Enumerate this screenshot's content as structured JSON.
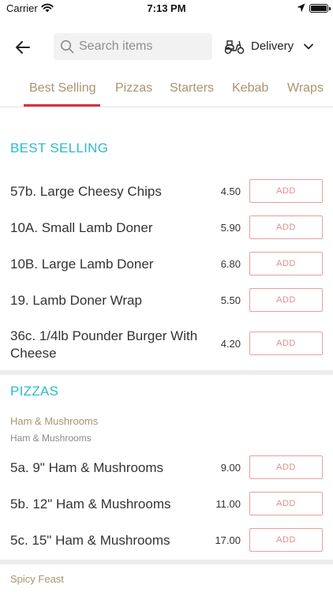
{
  "status_bar": {
    "carrier": "Carrier",
    "time": "7:13 PM",
    "icons": [
      "wifi-icon",
      "location-icon",
      "battery-icon"
    ]
  },
  "header": {
    "back_icon": "arrow-left-icon",
    "search": {
      "placeholder": "Search items",
      "value": ""
    },
    "delivery": {
      "label": "Delivery",
      "icon": "scooter-icon"
    }
  },
  "tabs": [
    {
      "label": "Best Selling",
      "active": true
    },
    {
      "label": "Pizzas",
      "active": false
    },
    {
      "label": "Starters",
      "active": false
    },
    {
      "label": "Kebab",
      "active": false
    },
    {
      "label": "Wraps",
      "active": false
    }
  ],
  "colors": {
    "accent_teal": "#2bbcc9",
    "tab_text": "#a8946f",
    "active_indicator": "#d8313c",
    "add_button_border": "#e4a0a3"
  },
  "sections": {
    "best_selling": {
      "title": "BEST SELLING",
      "items": [
        {
          "name": "57b. Large Cheesy Chips",
          "price": "4.50",
          "button": "ADD"
        },
        {
          "name": "10A. Small Lamb Doner",
          "price": "5.90",
          "button": "ADD"
        },
        {
          "name": "10B. Large Lamb Doner",
          "price": "6.80",
          "button": "ADD"
        },
        {
          "name": "19. Lamb Doner Wrap",
          "price": "5.50",
          "button": "ADD"
        },
        {
          "name": "36c. 1/4lb Pounder Burger With Cheese",
          "price": "4.20",
          "button": "ADD"
        }
      ]
    },
    "pizzas": {
      "title": "PIZZAS",
      "group": {
        "title": "Ham & Mushrooms",
        "subtitle": "Ham & Mushrooms",
        "items": [
          {
            "name": "5a. 9\" Ham & Mushrooms",
            "price": "9.00",
            "button": "ADD"
          },
          {
            "name": "5b. 12\" Ham & Mushrooms",
            "price": "11.00",
            "button": "ADD"
          },
          {
            "name": "5c. 15\" Ham & Mushrooms",
            "price": "17.00",
            "button": "ADD"
          }
        ]
      },
      "next_group_title": "Spicy Feast"
    }
  }
}
